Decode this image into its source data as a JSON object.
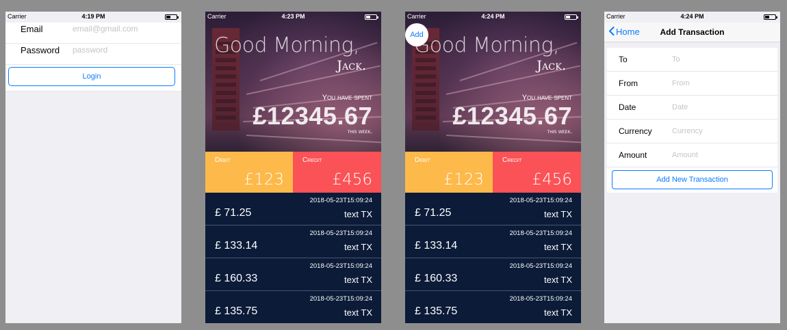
{
  "login": {
    "status": {
      "carrier": "Carrier",
      "time": "4:19 PM"
    },
    "email_label": "Email",
    "email_placeholder": "email@gmail.com",
    "password_label": "Password",
    "password_placeholder": "password",
    "login_button": "Login"
  },
  "dashboard_1": {
    "status": {
      "carrier": "Carrier",
      "time": "4:23 PM"
    }
  },
  "dashboard_2": {
    "status": {
      "carrier": "Carrier",
      "time": "4:24 PM"
    },
    "add_button": "Add"
  },
  "dashboard": {
    "greeting": "Good Morning,",
    "user_name": "Jack.",
    "spent_label": "You have spent",
    "spent_amount": "£12345.67",
    "period_label": "this week.",
    "debit_label": "Debit",
    "debit_amount": "£123",
    "credit_label": "Credit",
    "credit_amount": "£456",
    "colors": {
      "debit": "#fdb94a",
      "credit": "#fa5256",
      "list_bg": "#0b1b38"
    },
    "transactions": [
      {
        "date": "2018-05-23T15:09:24",
        "amount": "£ 71.25",
        "desc": "text TX"
      },
      {
        "date": "2018-05-23T15:09:24",
        "amount": "£ 133.14",
        "desc": "text TX"
      },
      {
        "date": "2018-05-23T15:09:24",
        "amount": "£ 160.33",
        "desc": "text TX"
      },
      {
        "date": "2018-05-23T15:09:24",
        "amount": "£ 135.75",
        "desc": "text TX"
      }
    ]
  },
  "add_transaction": {
    "status": {
      "carrier": "Carrier",
      "time": "4:24 PM"
    },
    "back_label": "Home",
    "title": "Add Transaction",
    "fields": [
      {
        "label": "To",
        "placeholder": "To"
      },
      {
        "label": "From",
        "placeholder": "From"
      },
      {
        "label": "Date",
        "placeholder": "Date"
      },
      {
        "label": "Currency",
        "placeholder": "Currency"
      },
      {
        "label": "Amount",
        "placeholder": "Amount"
      }
    ],
    "submit_button": "Add New Transaction",
    "accent": "#0a7bff"
  }
}
